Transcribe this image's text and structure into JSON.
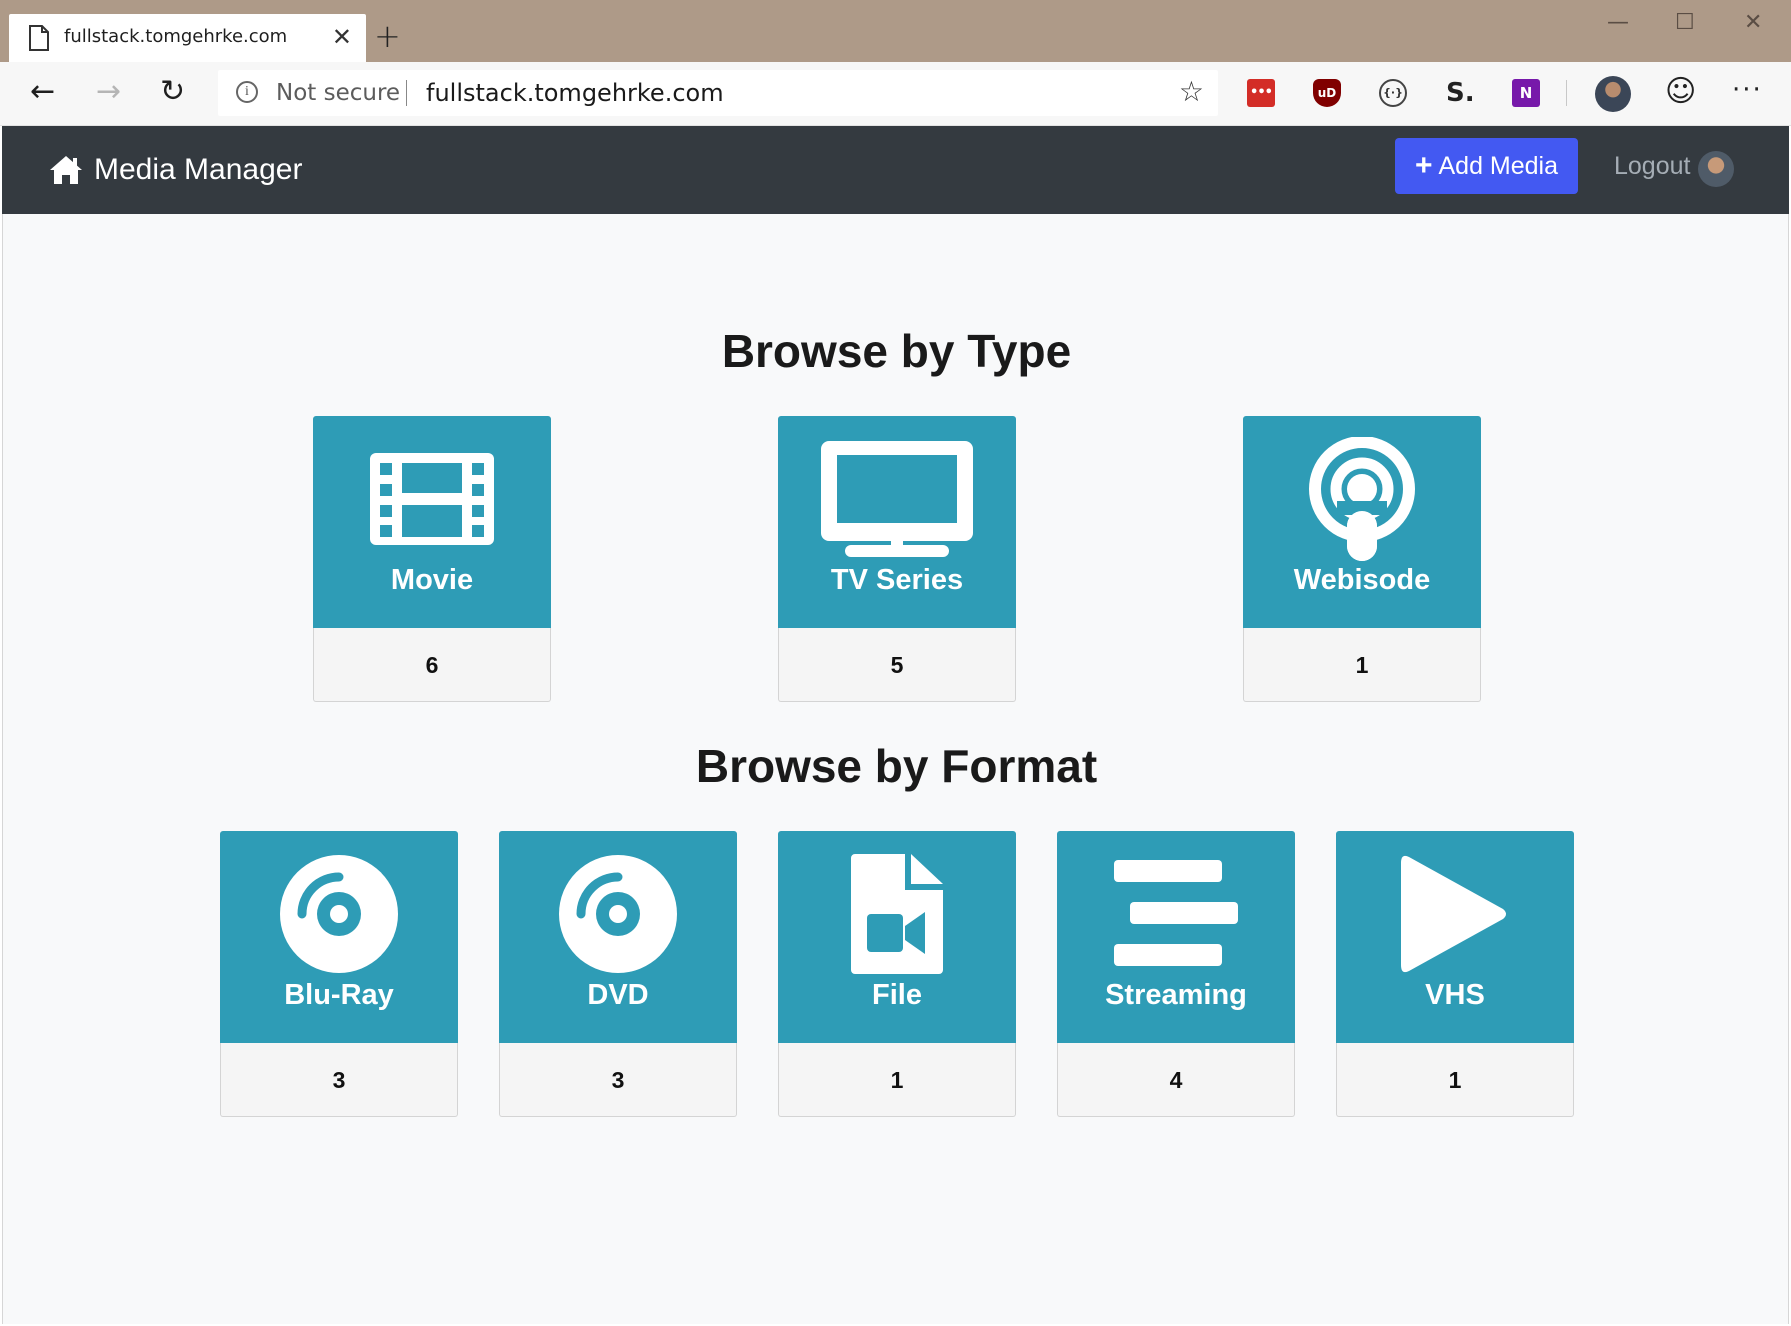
{
  "browser": {
    "tab_title": "fullstack.tomgehrke.com",
    "tab_close": "✕",
    "new_tab": "+",
    "window_min": "—",
    "window_max": "☐",
    "window_close": "✕",
    "back": "←",
    "forward": "→",
    "reload": "↻",
    "not_secure": "Not secure",
    "url": "fullstack.tomgehrke.com",
    "favorite": "☆",
    "more": "···",
    "smiley": "☺"
  },
  "extensions": [
    {
      "name": "lastpass",
      "glyph": "•••"
    },
    {
      "name": "ublock",
      "glyph": "uD"
    },
    {
      "name": "json-viewer",
      "glyph": "{·}"
    },
    {
      "name": "s-extension",
      "glyph": "S."
    },
    {
      "name": "onenote",
      "glyph": "N"
    }
  ],
  "navbar": {
    "brand": "Media Manager",
    "add_media": "Add Media",
    "add_media_icon": "+",
    "logout": "Logout",
    "background_color": "#343a40",
    "button_color": "#4359f2"
  },
  "types": {
    "title": "Browse by Type",
    "items": [
      {
        "label": "Movie",
        "count": "6",
        "icon": "film-icon"
      },
      {
        "label": "TV Series",
        "count": "5",
        "icon": "tv-icon"
      },
      {
        "label": "Webisode",
        "count": "1",
        "icon": "podcast-icon"
      }
    ]
  },
  "formats": {
    "title": "Browse by Format",
    "items": [
      {
        "label": "Blu-Ray",
        "count": "3",
        "icon": "compact-disc-icon"
      },
      {
        "label": "DVD",
        "count": "3",
        "icon": "compact-disc-icon"
      },
      {
        "label": "File",
        "count": "1",
        "icon": "file-video-icon"
      },
      {
        "label": "Streaming",
        "count": "4",
        "icon": "stream-icon"
      },
      {
        "label": "VHS",
        "count": "1",
        "icon": "play-icon"
      }
    ]
  },
  "colors": {
    "card": "#2e9cb6",
    "page_bg": "#f8f9fa",
    "titlebar": "#ae9a88"
  }
}
